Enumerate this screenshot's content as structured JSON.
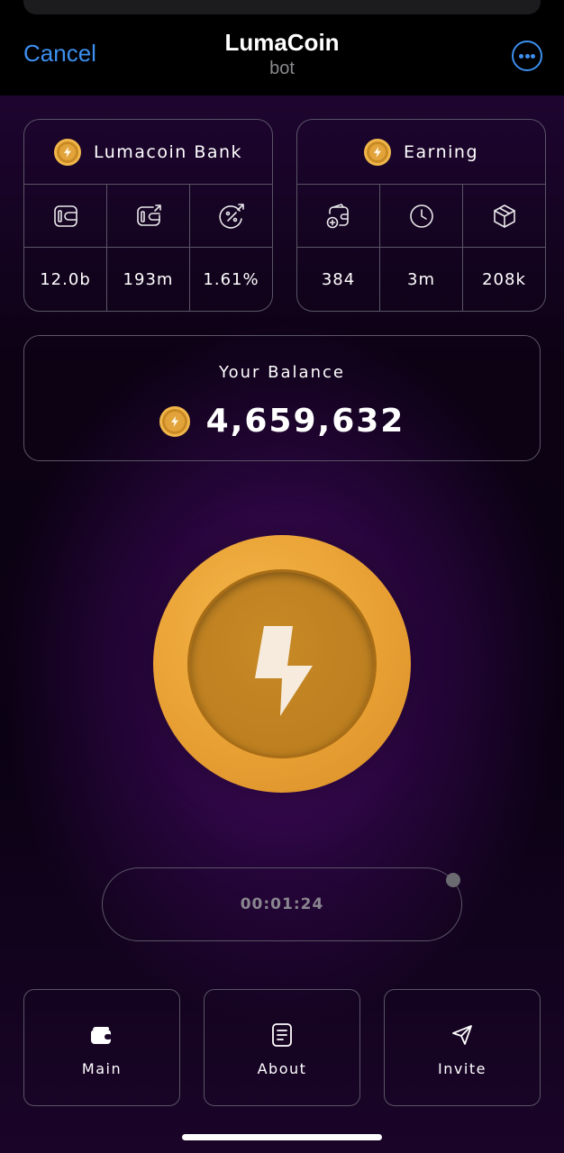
{
  "header": {
    "cancel_label": "Cancel",
    "title": "LumaCoin",
    "subtitle": "bot",
    "more_icon": "more-icon"
  },
  "bank": {
    "title": "Lumacoin Bank",
    "icons": [
      "wallet-icon",
      "card-transfer-icon",
      "percent-icon"
    ],
    "values": [
      "12.0b",
      "193m",
      "1.61%"
    ]
  },
  "earning": {
    "title": "Earning",
    "icons": [
      "wallet-add-icon",
      "clock-icon",
      "box-icon"
    ],
    "values": [
      "384",
      "3m",
      "208k"
    ]
  },
  "balance": {
    "label": "Your Balance",
    "value": "4,659,632"
  },
  "timer": {
    "value": "00:01:24"
  },
  "nav": [
    {
      "label": "Main",
      "icon": "wallet-icon"
    },
    {
      "label": "About",
      "icon": "document-icon"
    },
    {
      "label": "Invite",
      "icon": "send-icon"
    }
  ],
  "colors": {
    "accent": "#3d8ff0",
    "coin": "#e8a034",
    "border": "#5a5566",
    "background": "#0a0112"
  }
}
